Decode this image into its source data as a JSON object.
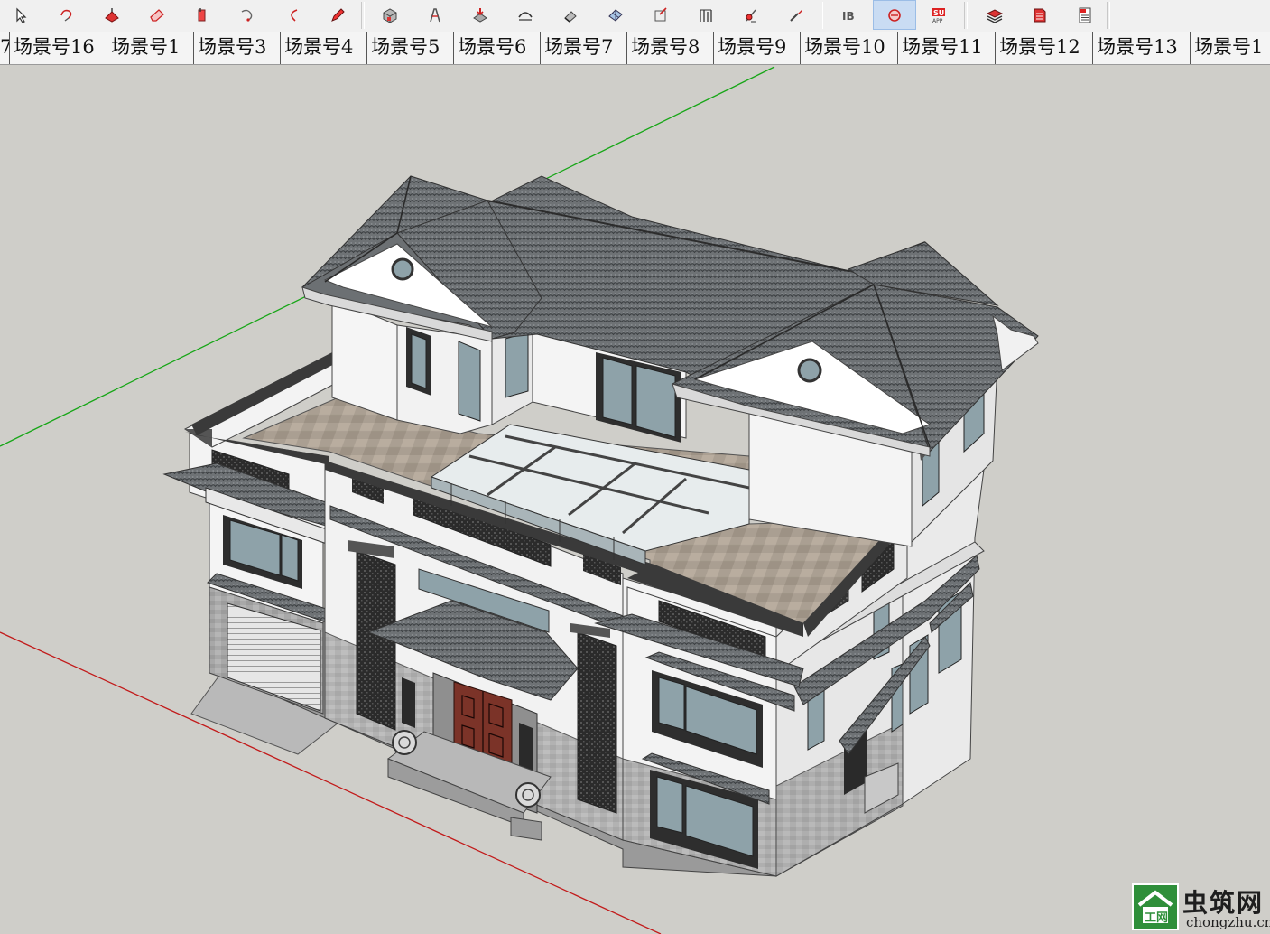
{
  "toolbar": {
    "groups": [
      {
        "name": "drawing-tools",
        "buttons": [
          "select-icon",
          "lasso-icon",
          "pushpull-icon",
          "eraser-icon",
          "paint-icon",
          "rotate-icon",
          "arc-icon",
          "pencil-icon"
        ]
      },
      {
        "name": "modify-tools",
        "buttons": [
          "box-icon",
          "followme-icon",
          "offset-icon",
          "arch-icon",
          "eraser2-icon",
          "component-icon",
          "scale-icon",
          "walls-icon",
          "tape-icon",
          "paint-brush-icon"
        ]
      },
      {
        "name": "extension-tools",
        "buttons": [
          "extension-b-icon",
          "extension-active-icon",
          "extension-su-icon"
        ]
      },
      {
        "name": "layer-tools",
        "buttons": [
          "layers-icon",
          "layer-book-icon",
          "report-icon"
        ]
      }
    ],
    "active_button": "extension-active-icon"
  },
  "scene_tabs": {
    "partial_first": "7",
    "items": [
      "场景号16",
      "场景号1",
      "场景号3",
      "场景号4",
      "场景号5",
      "场景号6",
      "场景号7",
      "场景号8",
      "场景号9",
      "场景号10",
      "场景号11",
      "场景号12",
      "场景号13",
      "场景号1"
    ]
  },
  "viewport": {
    "background": "#cfcec9",
    "axis_colors": {
      "green": "#17a617",
      "red": "#c21a1a"
    },
    "model": "3-storey villa with hipped tiled roofs, roof terrace and glass skylight"
  },
  "watermark": {
    "chinese": "虫筑网",
    "domain": "chongzhu.cn",
    "logo_letters": "工网",
    "color": "#2f8f3a"
  }
}
